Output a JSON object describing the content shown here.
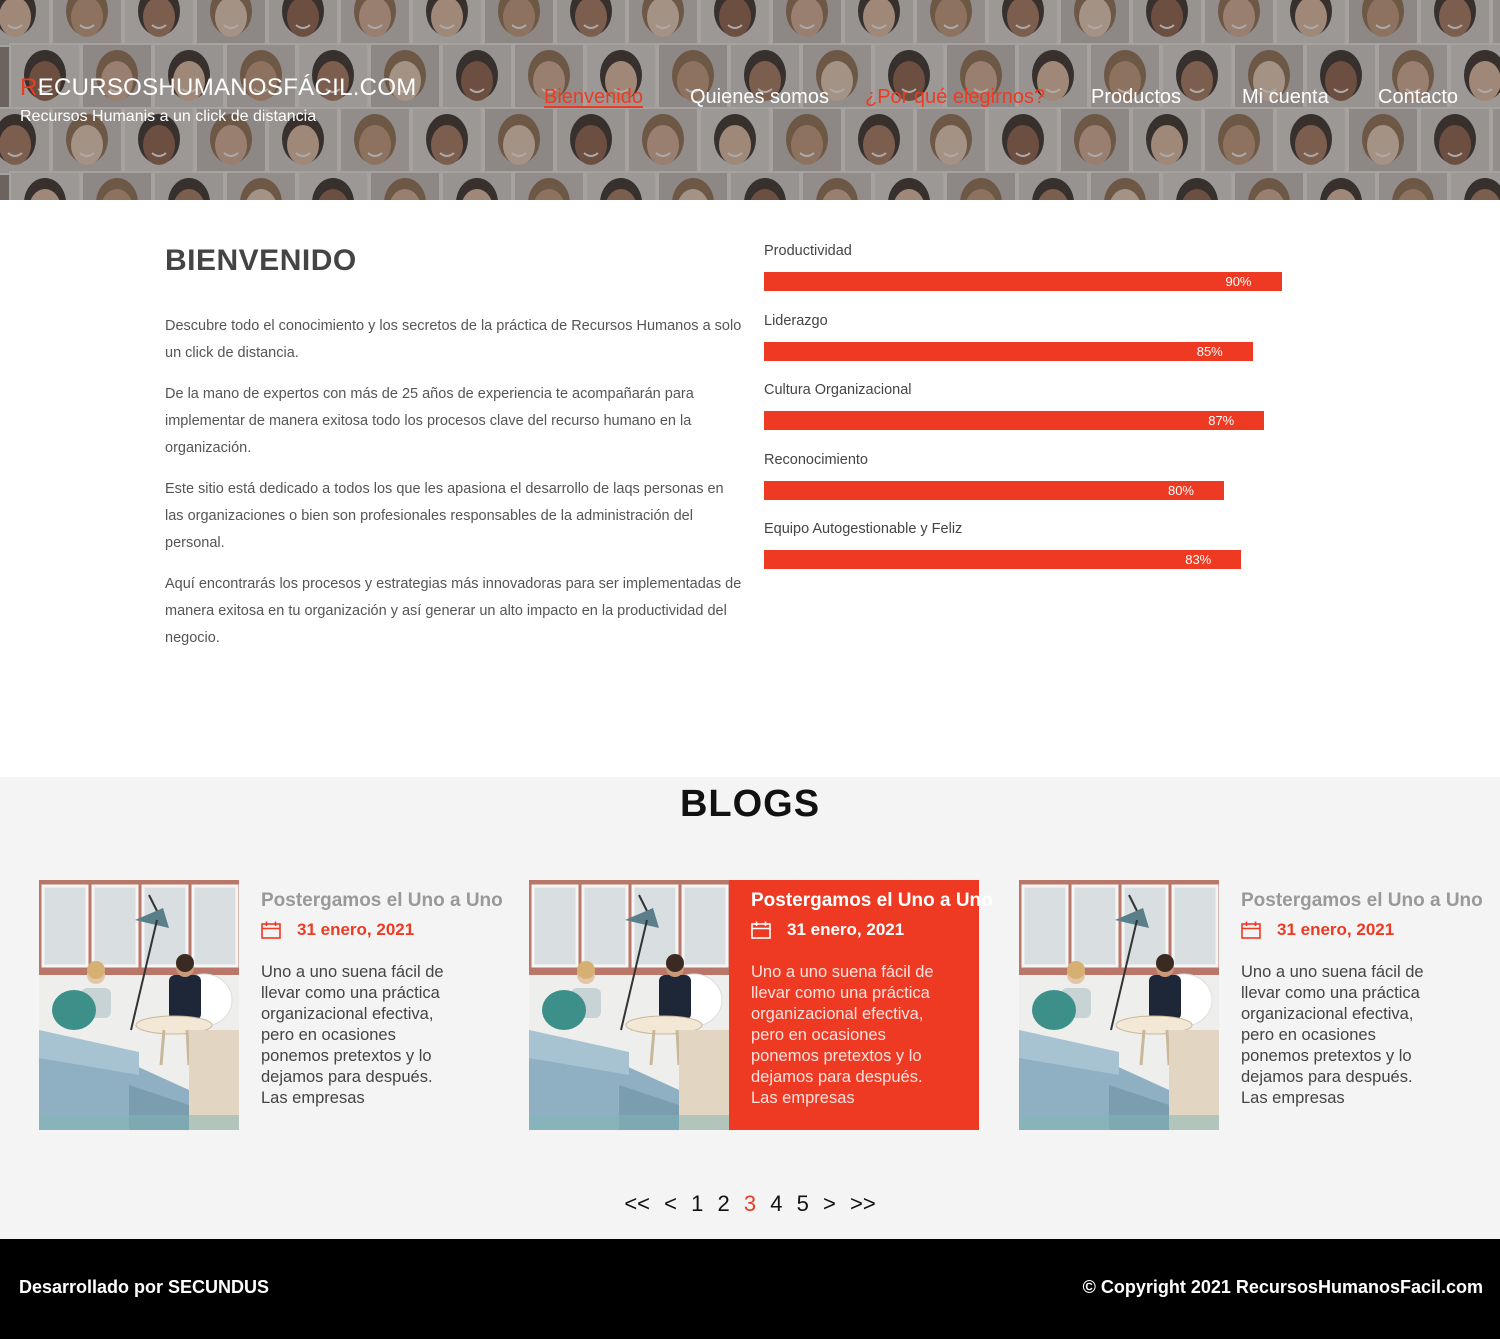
{
  "header": {
    "brand_initial": "R",
    "brand_rest": "ECURSOSHUMANOSFÁCIL.COM",
    "tagline": "Recursos Humanis a un click de distancia",
    "nav": [
      {
        "label": "Bienvenido"
      },
      {
        "label": "Quienes somos"
      },
      {
        "label": "¿Por qué elegirnos?"
      },
      {
        "label": "Productos"
      },
      {
        "label": "Mi cuenta"
      },
      {
        "label": "Contacto"
      }
    ]
  },
  "welcome": {
    "title": "BIENVENIDO",
    "paragraphs": [
      "Descubre todo el conocimiento y los secretos de la práctica de Recursos Humanos a solo un click de distancia.",
      "De la mano de expertos con más de 25 años de experiencia te acompañarán para implementar de manera exitosa todo los procesos clave del recurso humano en la organización.",
      "Este sitio está dedicado a todos los que les apasiona el desarrollo de laqs personas en las organizaciones o bien son profesionales responsables  de la administración del personal.",
      "Aquí encontrarás los procesos y estrategias más innovadoras para ser implementadas de manera exitosa en tu organización y así generar un alto impacto en la productividad del negocio."
    ]
  },
  "skills": [
    {
      "label": "Productividad",
      "value": 90,
      "value_label": "90%"
    },
    {
      "label": "Liderazgo",
      "value": 85,
      "value_label": "85%"
    },
    {
      "label": "Cultura Organizacional",
      "value": 87,
      "value_label": "87%"
    },
    {
      "label": "Reconocimiento",
      "value": 80,
      "value_label": "80%"
    },
    {
      "label": "Equipo Autogestionable y Feliz",
      "value": 83,
      "value_label": "83%"
    }
  ],
  "blogs": {
    "title": "BLOGS",
    "posts": [
      {
        "title": "Postergamos el Uno a Uno",
        "date": "31 enero, 2021",
        "excerpt": "Uno a uno suena fácil de llevar como una práctica organizacional efectiva, pero en ocasiones ponemos pretextos y lo dejamos para después. Las empresas"
      },
      {
        "title": "Postergamos el Uno a Uno",
        "date": "31 enero, 2021",
        "excerpt": "Uno a uno suena fácil de llevar como una práctica organizacional efectiva, pero en ocasiones ponemos pretextos y lo dejamos para después. Las empresas"
      },
      {
        "title": "Postergamos el Uno a Uno",
        "date": "31 enero, 2021",
        "excerpt": "Uno a uno suena fácil de llevar como una práctica organizacional efectiva, pero en ocasiones ponemos pretextos y lo dejamos para después. Las empresas"
      }
    ]
  },
  "pagination": {
    "first": "<<",
    "prev": "<",
    "pages": [
      "1",
      "2",
      "3",
      "4",
      "5"
    ],
    "current": "3",
    "next": ">",
    "last": ">>"
  },
  "footer": {
    "left": "Desarrollado por SECUNDUS",
    "right": "© Copyright 2021 RecursosHumanosFacil.com"
  },
  "colors": {
    "accent": "#ee3a23",
    "footer_bg": "#000000",
    "blogs_bg": "#f4f4f4"
  }
}
